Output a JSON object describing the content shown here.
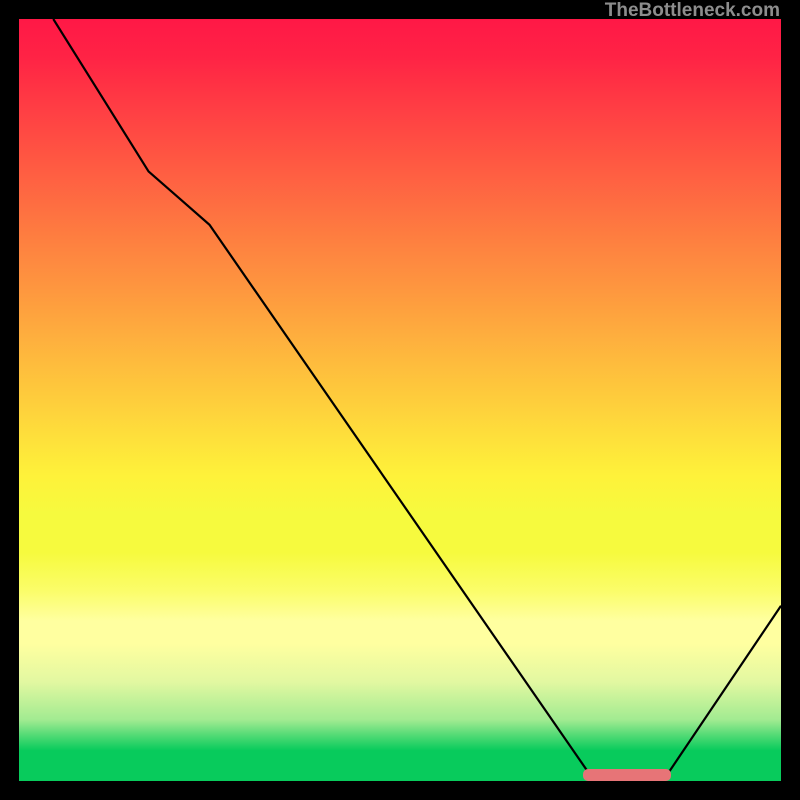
{
  "watermark": "TheBottleneck.com",
  "chart_data": {
    "type": "line",
    "title": "",
    "xlabel": "",
    "ylabel": "",
    "xlim": [
      0,
      100
    ],
    "ylim": [
      0,
      100
    ],
    "gradient_stops": [
      {
        "offset": 0.0,
        "color": "#ff1846"
      },
      {
        "offset": 0.05,
        "color": "#ff2345"
      },
      {
        "offset": 0.1,
        "color": "#ff3744"
      },
      {
        "offset": 0.15,
        "color": "#ff4a43"
      },
      {
        "offset": 0.2,
        "color": "#ff5d42"
      },
      {
        "offset": 0.25,
        "color": "#fe7041"
      },
      {
        "offset": 0.3,
        "color": "#fe8340"
      },
      {
        "offset": 0.35,
        "color": "#fe953f"
      },
      {
        "offset": 0.4,
        "color": "#fea83e"
      },
      {
        "offset": 0.45,
        "color": "#febb3d"
      },
      {
        "offset": 0.5,
        "color": "#fecd3c"
      },
      {
        "offset": 0.55,
        "color": "#fee03b"
      },
      {
        "offset": 0.6,
        "color": "#fef23a"
      },
      {
        "offset": 0.65,
        "color": "#f6fa3e"
      },
      {
        "offset": 0.7,
        "color": "#f6fa3e"
      },
      {
        "offset": 0.75,
        "color": "#fbfd69"
      },
      {
        "offset": 0.79,
        "color": "#ffffa0"
      },
      {
        "offset": 0.82,
        "color": "#ffffa0"
      },
      {
        "offset": 0.87,
        "color": "#e2f8a1"
      },
      {
        "offset": 0.92,
        "color": "#a1eb91"
      },
      {
        "offset": 0.94,
        "color": "#52da75"
      },
      {
        "offset": 0.96,
        "color": "#08cb5c"
      },
      {
        "offset": 1.0,
        "color": "#08cb5c"
      }
    ],
    "curve": {
      "x": [
        4.5,
        17,
        25,
        75.5,
        84.5,
        100
      ],
      "y": [
        100,
        80,
        73,
        0,
        0,
        23
      ]
    },
    "marker": {
      "x_start": 74,
      "x_end": 85.5,
      "y": 0.8
    }
  }
}
